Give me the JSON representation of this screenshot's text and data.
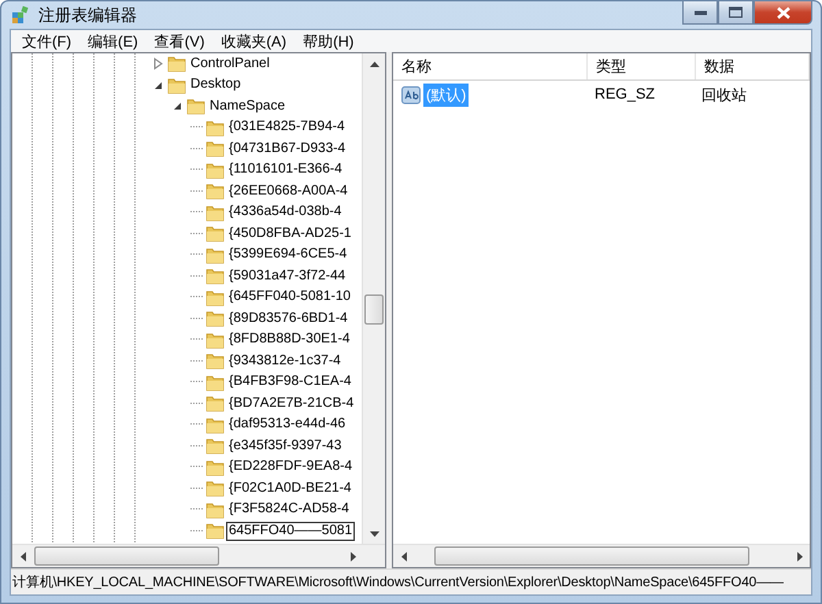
{
  "window": {
    "title": "注册表编辑器"
  },
  "menu": [
    "文件(F)",
    "编辑(E)",
    "查看(V)",
    "收藏夹(A)",
    "帮助(H)"
  ],
  "tree": [
    {
      "label": "ControlPanel",
      "expanded": false,
      "selected": false
    },
    {
      "label": "Desktop",
      "expanded": true,
      "selected": false,
      "children": [
        {
          "label": "NameSpace",
          "expanded": true,
          "selected": false,
          "children": [
            {
              "label": "{031E4825-7B94-4",
              "selected": false
            },
            {
              "label": "{04731B67-D933-4",
              "selected": false
            },
            {
              "label": "{11016101-E366-4",
              "selected": false
            },
            {
              "label": "{26EE0668-A00A-4",
              "selected": false
            },
            {
              "label": "{4336a54d-038b-4",
              "selected": false
            },
            {
              "label": "{450D8FBA-AD25-1",
              "selected": false
            },
            {
              "label": "{5399E694-6CE5-4",
              "selected": false
            },
            {
              "label": "{59031a47-3f72-44",
              "selected": false
            },
            {
              "label": "{645FF040-5081-10",
              "selected": false
            },
            {
              "label": "{89D83576-6BD1-4",
              "selected": false
            },
            {
              "label": "{8FD8B88D-30E1-4",
              "selected": false
            },
            {
              "label": "{9343812e-1c37-4",
              "selected": false
            },
            {
              "label": "{B4FB3F98-C1EA-4",
              "selected": false
            },
            {
              "label": "{BD7A2E7B-21CB-4",
              "selected": false
            },
            {
              "label": "{daf95313-e44d-46",
              "selected": false
            },
            {
              "label": "{e345f35f-9397-43",
              "selected": false
            },
            {
              "label": "{ED228FDF-9EA8-4",
              "selected": false
            },
            {
              "label": "{F02C1A0D-BE21-4",
              "selected": false
            },
            {
              "label": "{F3F5824C-AD58-4",
              "selected": false
            },
            {
              "label": "645FFO40——5081",
              "selected": true
            }
          ]
        }
      ]
    }
  ],
  "list": {
    "columns": [
      "名称",
      "类型",
      "数据"
    ],
    "rows": [
      {
        "name": "(默认)",
        "type": "REG_SZ",
        "data": "回收站",
        "selected": true
      }
    ]
  },
  "status_bar": "计算机\\HKEY_LOCAL_MACHINE\\SOFTWARE\\Microsoft\\Windows\\CurrentVersion\\Explorer\\Desktop\\NameSpace\\645FFO40——"
}
